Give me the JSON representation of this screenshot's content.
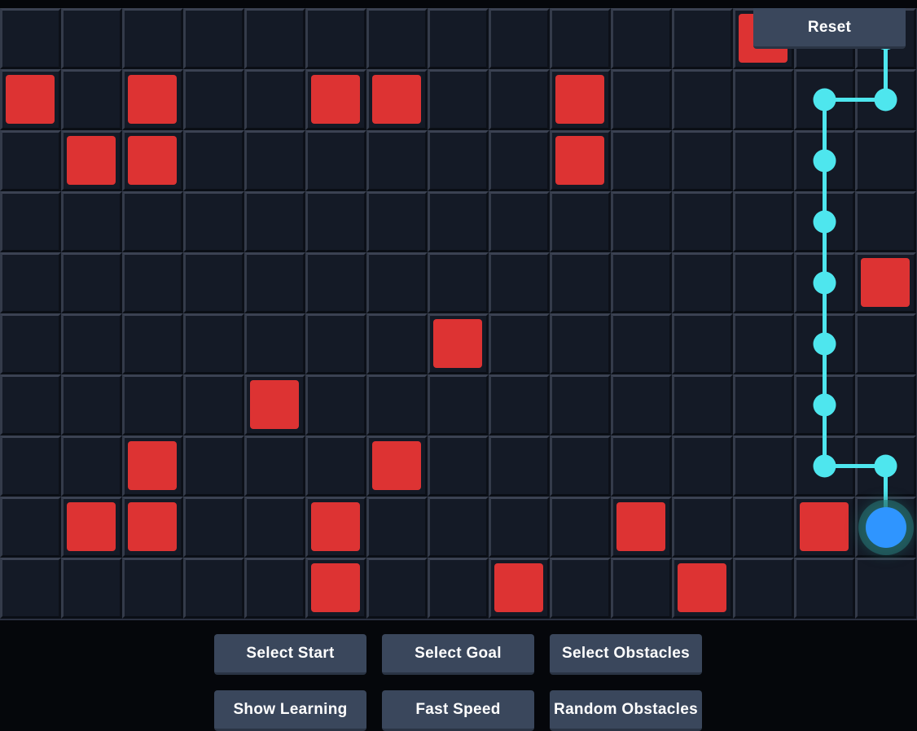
{
  "grid": {
    "cols": 15,
    "rows": 10,
    "obstacles": [
      [
        12,
        0
      ],
      [
        0,
        1
      ],
      [
        2,
        1
      ],
      [
        5,
        1
      ],
      [
        6,
        1
      ],
      [
        9,
        1
      ],
      [
        1,
        2
      ],
      [
        2,
        2
      ],
      [
        9,
        2
      ],
      [
        14,
        4
      ],
      [
        7,
        5
      ],
      [
        4,
        6
      ],
      [
        2,
        7
      ],
      [
        6,
        7
      ],
      [
        1,
        8
      ],
      [
        2,
        8
      ],
      [
        5,
        8
      ],
      [
        10,
        8
      ],
      [
        13,
        8
      ],
      [
        5,
        9
      ],
      [
        8,
        9
      ],
      [
        11,
        9
      ]
    ],
    "agent": [
      14,
      8
    ],
    "path": [
      [
        14,
        8
      ],
      [
        14,
        7
      ],
      [
        13,
        7
      ],
      [
        13,
        6
      ],
      [
        13,
        5
      ],
      [
        13,
        4
      ],
      [
        13,
        3
      ],
      [
        13,
        2
      ],
      [
        13,
        1
      ],
      [
        14,
        1
      ],
      [
        14,
        0
      ]
    ]
  },
  "colors": {
    "cell": "#141a26",
    "obstacle": "#dd3333",
    "path": "#4ee6ee",
    "agent": "#2f95ff",
    "button": "#3a475c"
  },
  "controls": {
    "reset": "Reset",
    "select_start": "Select Start",
    "select_goal": "Select Goal",
    "select_obstacles": "Select Obstacles",
    "show_learning": "Show Learning",
    "fast_speed": "Fast Speed",
    "random_obstacles": "Random Obstacles"
  }
}
